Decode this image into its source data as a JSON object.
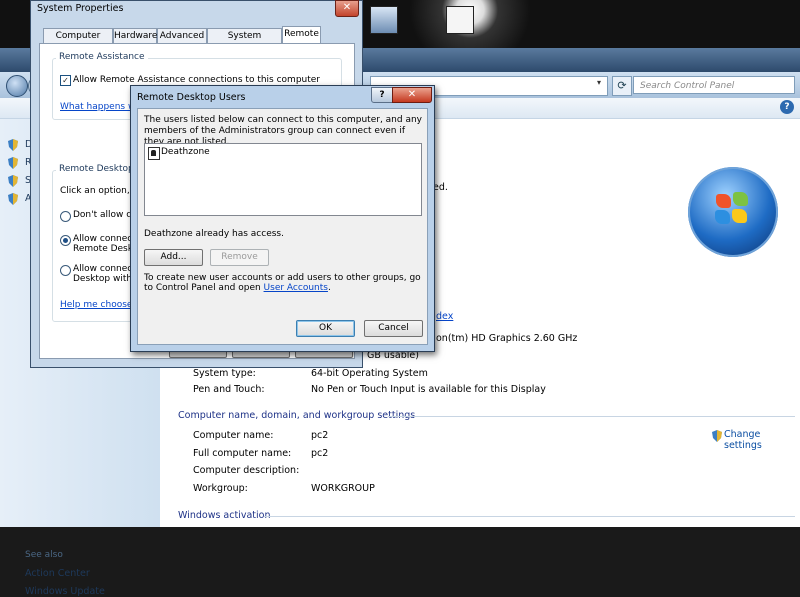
{
  "colors": {
    "link": "#0645c8",
    "heading": "#1e3287",
    "sidebar": "#dde9f5",
    "close_button": "#c4381f"
  },
  "control_panel": {
    "search_placeholder": "Search Control Panel",
    "sidebar": {
      "items": [
        "D",
        "R",
        "S",
        "A"
      ],
      "see_also": "See also",
      "see_also_links": [
        "Action Center",
        "Windows Update"
      ]
    },
    "system": {
      "brand_fragment": "dex",
      "processor_fragment": "on(tm) HD Graphics   2.60 GHz",
      "memory_fragment": "GB usable)",
      "rating_fragment": "ed.",
      "rows": [
        {
          "label": "System type:",
          "value": "64-bit Operating System"
        },
        {
          "label": "Pen and Touch:",
          "value": "No Pen or Touch Input is available for this Display"
        }
      ]
    },
    "computer_section": {
      "heading": "Computer name, domain, and workgroup settings",
      "change_settings": "Change settings",
      "rows": [
        {
          "label": "Computer name:",
          "value": "pc2"
        },
        {
          "label": "Full computer name:",
          "value": "pc2"
        },
        {
          "label": "Computer description:",
          "value": ""
        },
        {
          "label": "Workgroup:",
          "value": "WORKGROUP"
        }
      ]
    },
    "activation_heading": "Windows activation"
  },
  "system_properties": {
    "title": "System Properties",
    "close": "✕",
    "tabs": [
      "Computer Name",
      "Hardware",
      "Advanced",
      "System Protection",
      "Remote"
    ],
    "remote_assistance": {
      "group_title": "Remote Assistance",
      "allow_checkbox": "Allow Remote Assistance connections to this computer",
      "allow_checked": true,
      "link": "What happens whe"
    },
    "remote_desktop": {
      "group_title": "Remote Desktop",
      "intro": "Click an option, and",
      "options": [
        {
          "line1": "Don't allow conn",
          "line2": "",
          "selected": false
        },
        {
          "line1": "Allow connection",
          "line2": "Remote Deskto",
          "selected": true
        },
        {
          "line1": "Allow connection",
          "line2": "Desktop with N",
          "selected": false
        }
      ],
      "help_link": "Help me choose"
    }
  },
  "remote_desktop_users": {
    "title": "Remote Desktop Users",
    "help": "?",
    "close": "✕",
    "description": "The users listed below can connect to this computer, and any members of the Administrators group can connect even if they are not listed.",
    "users": [
      "Deathzone"
    ],
    "access_text": "Deathzone already has access.",
    "add_button": "Add...",
    "remove_button": "Remove",
    "info_text": "To create new user accounts or add users to other groups, go to Control Panel and open ",
    "info_link": "User Accounts",
    "info_end": ".",
    "ok_button": "OK",
    "cancel_button": "Cancel"
  }
}
